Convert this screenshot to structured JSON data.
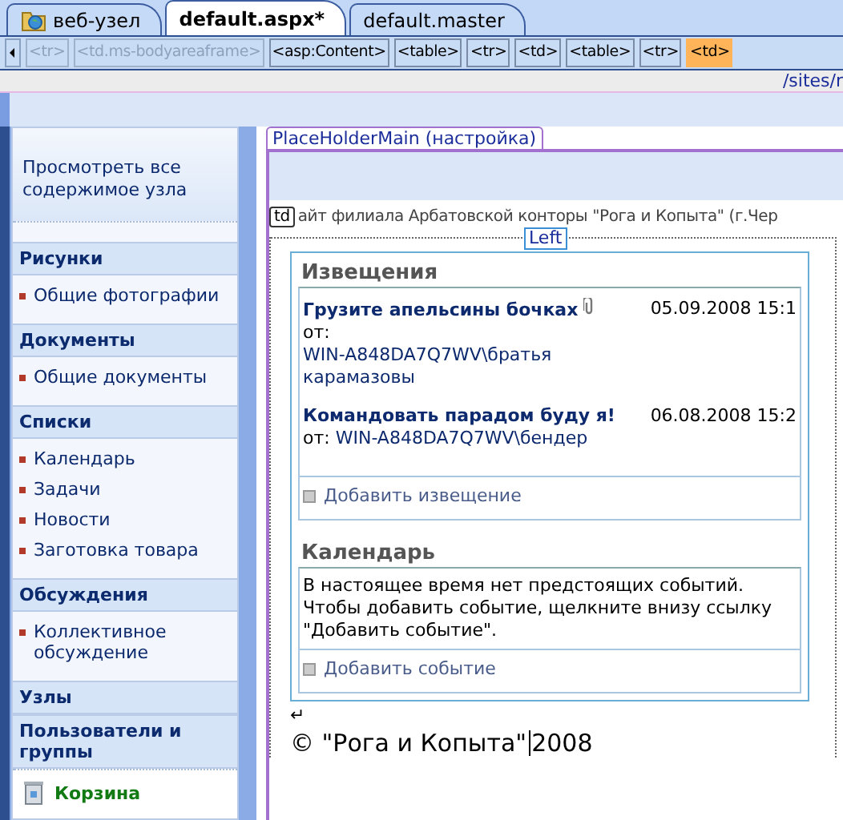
{
  "tabs": [
    {
      "label": "веб-узел",
      "kind": "site",
      "selected": false
    },
    {
      "label": "default.aspx*",
      "kind": "file",
      "selected": true
    },
    {
      "label": "default.master",
      "kind": "file",
      "selected": false
    }
  ],
  "tag_path": [
    {
      "label": "<tr>",
      "disabled": true,
      "selected": false
    },
    {
      "label": "<td.ms-bodyareaframe>",
      "disabled": true,
      "selected": false
    },
    {
      "label": "<asp:Content>",
      "disabled": false,
      "selected": false
    },
    {
      "label": "<table>",
      "disabled": false,
      "selected": false
    },
    {
      "label": "<tr>",
      "disabled": false,
      "selected": false
    },
    {
      "label": "<td>",
      "disabled": false,
      "selected": false
    },
    {
      "label": "<table>",
      "disabled": false,
      "selected": false
    },
    {
      "label": "<tr>",
      "disabled": false,
      "selected": false
    },
    {
      "label": "<td>",
      "disabled": false,
      "selected": true
    }
  ],
  "url_fragment": "/sites/r",
  "sidebar": {
    "top_link": "Просмотреть все содержимое узла",
    "sections": [
      {
        "heading": "Рисунки",
        "items": [
          "Общие фотографии"
        ]
      },
      {
        "heading": "Документы",
        "items": [
          "Общие документы"
        ]
      },
      {
        "heading": "Списки",
        "items": [
          "Календарь",
          "Задачи",
          "Новости",
          "Заготовка товара"
        ]
      },
      {
        "heading": "Обсуждения",
        "items": [
          "Коллективное обсуждение"
        ]
      },
      {
        "heading": "Узлы"
      },
      {
        "heading": "Пользователи и группы"
      }
    ],
    "recycle_bin": "Корзина"
  },
  "placeholder_label": "PlaceHolderMain (настройка)",
  "cell_tag": "td",
  "site_title_line": "айт филиала Арбатовской конторы \"Рога и Копыта\" (г.Чер",
  "zone_label": "Left",
  "announcements": {
    "title": "Извещения",
    "items": [
      {
        "title": "Грузите апельсины бочках",
        "attachment": true,
        "from_label": "от:",
        "author": "WIN-A848DA7Q7WV\\братья карамазовы",
        "date": "05.09.2008 15:1"
      },
      {
        "title": "Командовать парадом буду я!",
        "attachment": false,
        "from_label": "от:",
        "author": "WIN-A848DA7Q7WV\\бендер",
        "date": "06.08.2008 15:2"
      }
    ],
    "add_link": "Добавить извещение"
  },
  "calendar": {
    "title": "Календарь",
    "message": "В настоящее время нет предстоящих событий. Чтобы добавить событие, щелкните внизу ссылку \"Добавить событие\".",
    "add_link": "Добавить событие"
  },
  "paragraph_mark": "↵",
  "footer_text": "© \"Рога и Копыта\"",
  "footer_year": "2008"
}
